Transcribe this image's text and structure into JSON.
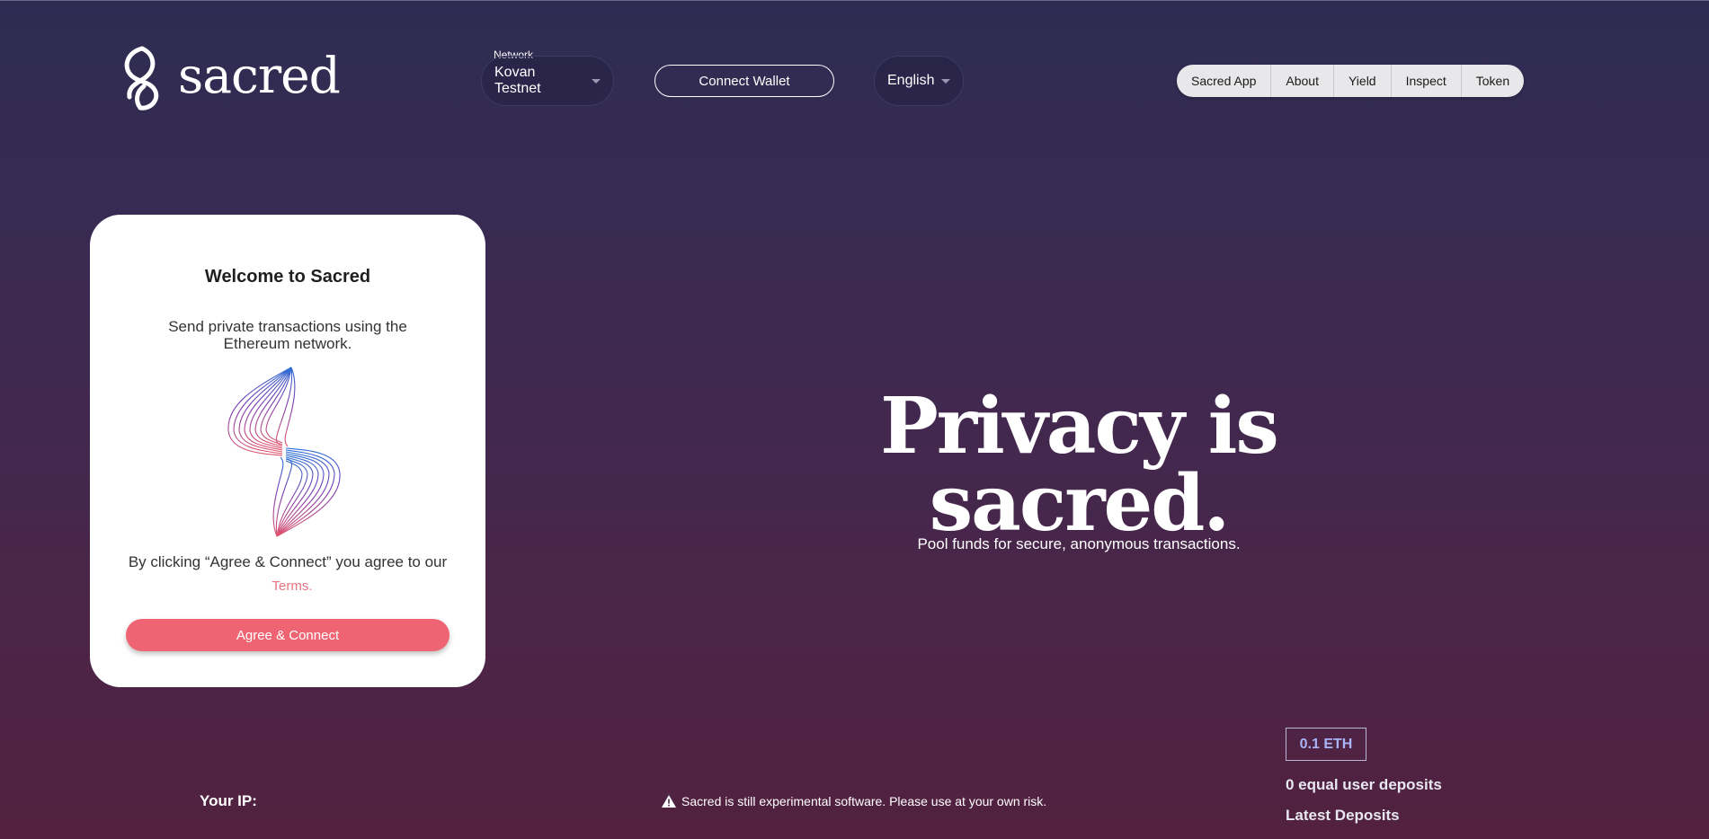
{
  "brand": {
    "name": "sacred"
  },
  "header": {
    "network_label": "Network",
    "network_value": "Kovan Testnet",
    "connect_wallet": "Connect Wallet",
    "language": "English",
    "nav": [
      "Sacred App",
      "About",
      "Yield",
      "Inspect",
      "Token"
    ]
  },
  "card": {
    "title": "Welcome to Sacred",
    "subtitle": "Send private transactions using the Ethereum network.",
    "terms_text": "By clicking “Agree & Connect” you agree to our",
    "terms_link": "Terms.",
    "agree_button": "Agree & Connect"
  },
  "hero": {
    "title": "Privacy is sacred.",
    "subtitle": "Pool funds for secure, anonymous transactions."
  },
  "footer": {
    "ip_label": "Your IP:",
    "warning": "Sacred is still experimental software. Please use at your own risk.",
    "pool_amount": "0.1 ETH",
    "deposits_count": "0 equal user deposits",
    "latest_deposits": "Latest Deposits"
  },
  "colors": {
    "accent": "#ef6472",
    "link": "#e8727f",
    "background_top": "#2e2c52",
    "background_bottom": "#52213f",
    "eth_badge_text": "#a8b4f5"
  },
  "icons": {
    "logo": "sacred-logo-icon",
    "warning": "warning-icon",
    "caret": "caret-down-icon",
    "illustration": "sacred-swirl-illustration"
  }
}
